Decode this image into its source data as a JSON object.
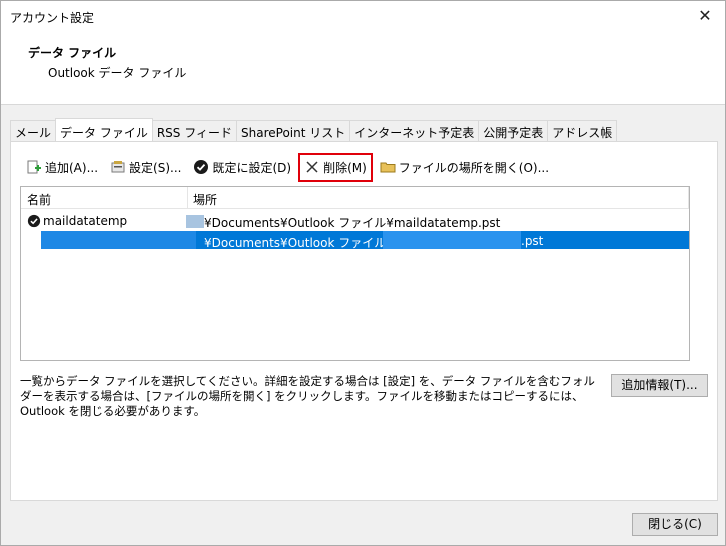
{
  "window": {
    "title": "アカウント設定",
    "close_glyph": "✕"
  },
  "header": {
    "title": "データ ファイル",
    "subtitle": "Outlook データ ファイル"
  },
  "tabs": [
    {
      "label": "メール",
      "active": false
    },
    {
      "label": "データ ファイル",
      "active": true
    },
    {
      "label": "RSS フィード",
      "active": false
    },
    {
      "label": "SharePoint リスト",
      "active": false
    },
    {
      "label": "インターネット予定表",
      "active": false
    },
    {
      "label": "公開予定表",
      "active": false
    },
    {
      "label": "アドレス帳",
      "active": false
    }
  ],
  "toolbar": {
    "add_label": "追加(A)...",
    "settings_label": "設定(S)...",
    "default_label": "既定に設定(D)",
    "delete_label": "削除(M)",
    "open_location_label": "ファイルの場所を開く(O)..."
  },
  "list": {
    "columns": [
      "名前",
      "場所"
    ],
    "rows": [
      {
        "name": "maildatatemp",
        "location": "¥Documents¥Outlook ファイル¥maildatatemp.pst",
        "default": true,
        "selected": false
      },
      {
        "name": "",
        "location_prefix": "¥Documents¥Outlook ファイル¥",
        "location_suffix": ".pst",
        "default": false,
        "selected": true
      }
    ]
  },
  "description": "一覧からデータ ファイルを選択してください。詳細を設定する場合は [設定] を、データ ファイルを含むフォルダーを表示する場合は、[ファイルの場所を開く] をクリックします。ファイルを移動またはコピーするには、Outlook を閉じる必要があります。",
  "more_info_label": "追加情報(T)...",
  "close_button_label": "閉じる(C)",
  "colors": {
    "selection": "#0078d7",
    "highlight_border": "#e0000a"
  }
}
